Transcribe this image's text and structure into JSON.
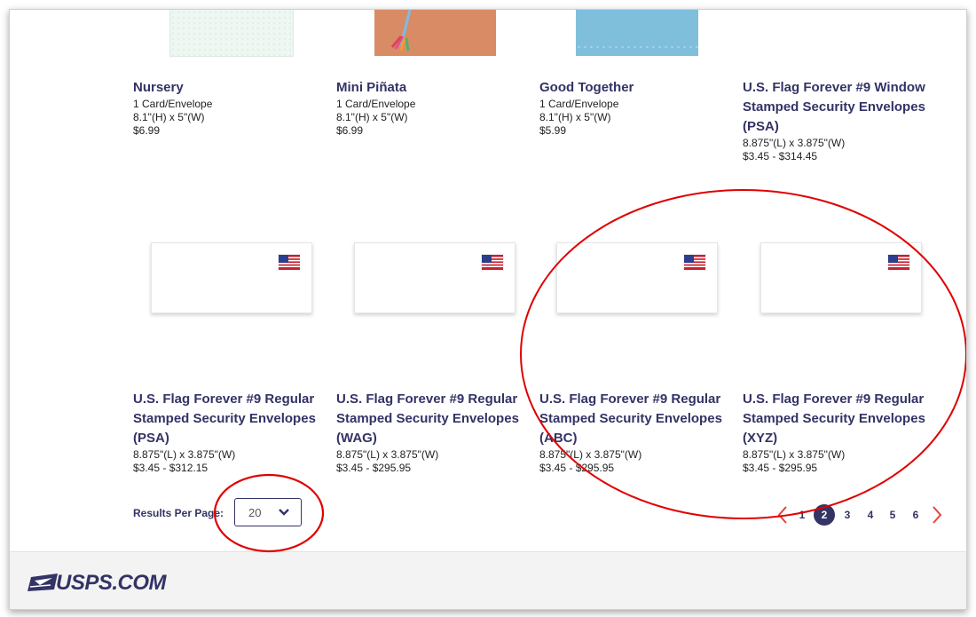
{
  "products_row1": [
    {
      "title": "Nursery",
      "lines": [
        "1 Card/Envelope",
        "8.1\"(H) x 5\"(W)",
        "$6.99"
      ]
    },
    {
      "title": "Mini Piñata",
      "lines": [
        "1 Card/Envelope",
        "8.1\"(H) x 5\"(W)",
        "$6.99"
      ]
    },
    {
      "title": "Good Together",
      "lines": [
        "1 Card/Envelope",
        "8.1\"(H) x 5\"(W)",
        "$5.99"
      ]
    },
    {
      "title": "U.S. Flag Forever #9 Window Stamped Security Envelopes (PSA)",
      "lines": [
        "8.875\"(L) x 3.875\"(W)",
        "$3.45 - $314.45"
      ]
    }
  ],
  "products_row2": [
    {
      "title": "U.S. Flag Forever #9 Regular Stamped Security Envelopes (PSA)",
      "lines": [
        "8.875\"(L) x 3.875\"(W)",
        "$3.45 - $312.15"
      ]
    },
    {
      "title": "U.S. Flag Forever #9 Regular Stamped Security Envelopes (WAG)",
      "lines": [
        "8.875\"(L) x 3.875\"(W)",
        "$3.45 - $295.95"
      ]
    },
    {
      "title": "U.S. Flag Forever #9 Regular Stamped Security Envelopes (ABC)",
      "lines": [
        "8.875\"(L) x 3.875\"(W)",
        "$3.45 - $295.95"
      ]
    },
    {
      "title": "U.S. Flag Forever #9 Regular Stamped Security Envelopes (XYZ)",
      "lines": [
        "8.875\"(L) x 3.875\"(W)",
        "$3.45 - $295.95"
      ]
    }
  ],
  "results_per_page": {
    "label": "Results Per Page:",
    "value": "20"
  },
  "pagination": {
    "pages": [
      "1",
      "2",
      "3",
      "4",
      "5",
      "6"
    ],
    "current": "2"
  },
  "footer": {
    "logo_text": "USPS.COM"
  },
  "colors": {
    "brand_navy": "#333366",
    "annotation_red": "#e00000"
  },
  "icons": {
    "prev": "chevron-left-icon",
    "next": "chevron-right-icon",
    "dropdown": "chevron-down-icon",
    "flag_stamp": "us-flag-stamp-icon"
  }
}
